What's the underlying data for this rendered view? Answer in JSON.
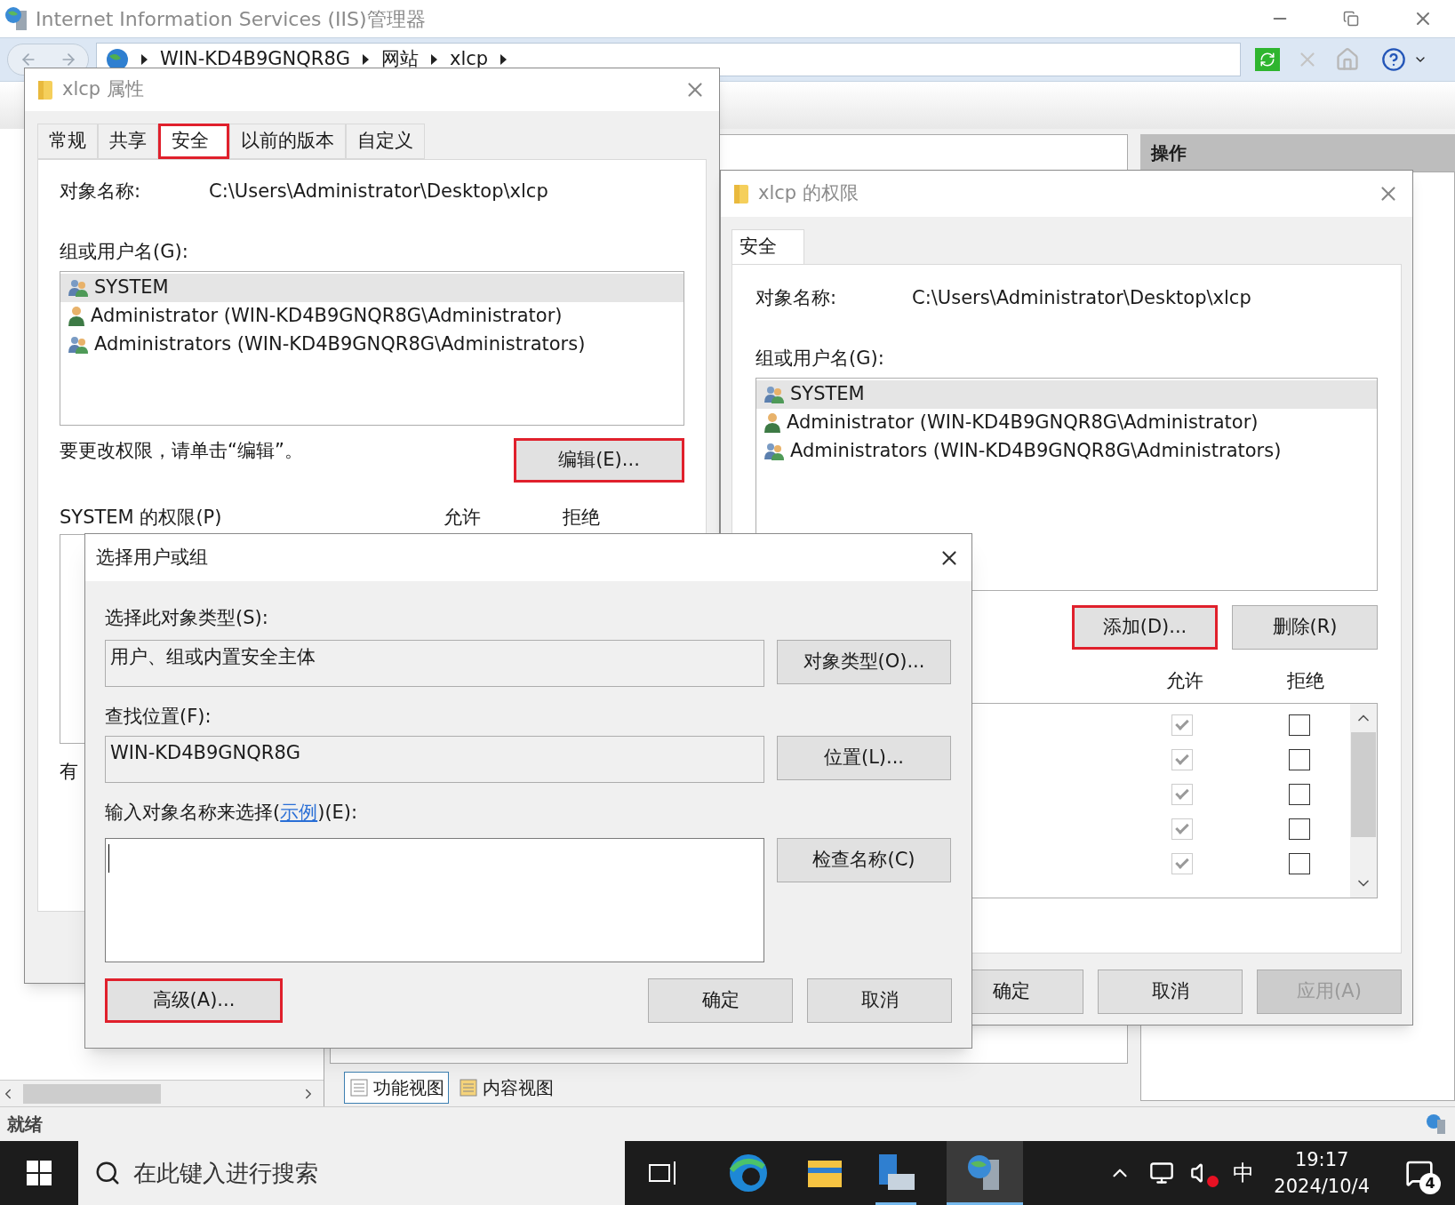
{
  "app": {
    "title": "Internet Information Services (IIS)管理器",
    "breadcrumb": [
      "WIN-KD4B9GNQR8G",
      "网站",
      "xlcp"
    ],
    "actions_header": "操作",
    "view_tabs": [
      {
        "label": "功能视图",
        "selected": true
      },
      {
        "label": "内容视图",
        "selected": false
      }
    ],
    "status": "就绪"
  },
  "properties_dialog": {
    "title": "xlcp 属性",
    "tabs": [
      {
        "label": "常规",
        "selected": false,
        "highlighted": false
      },
      {
        "label": "共享",
        "selected": false,
        "highlighted": false
      },
      {
        "label": "安全",
        "selected": true,
        "highlighted": true
      },
      {
        "label": "以前的版本",
        "selected": false,
        "highlighted": false
      },
      {
        "label": "自定义",
        "selected": false,
        "highlighted": false
      }
    ],
    "object_label": "对象名称:",
    "object_value": "C:\\Users\\Administrator\\Desktop\\xlcp",
    "users_label": "组或用户名(G):",
    "users": [
      {
        "name": "SYSTEM",
        "kind": "group",
        "selected": true
      },
      {
        "name": "Administrator (WIN-KD4B9GNQR8G\\Administrator)",
        "kind": "user",
        "selected": false
      },
      {
        "name": "Administrators (WIN-KD4B9GNQR8G\\Administrators)",
        "kind": "group",
        "selected": false
      }
    ],
    "hint": "要更改权限，请单击“编辑”。",
    "edit_button": {
      "label": "编辑(E)...",
      "highlighted": true
    },
    "permissions_label": "SYSTEM 的权限(P)",
    "allow_header": "允许",
    "deny_header": "拒绝",
    "footer_fragment": "有"
  },
  "permissions_dialog": {
    "title": "xlcp 的权限",
    "tabs": [
      {
        "label": "安全",
        "selected": true
      }
    ],
    "object_label": "对象名称:",
    "object_value": "C:\\Users\\Administrator\\Desktop\\xlcp",
    "users_label": "组或用户名(G):",
    "users": [
      {
        "name": "SYSTEM",
        "kind": "group",
        "selected": true
      },
      {
        "name": "Administrator (WIN-KD4B9GNQR8G\\Administrator)",
        "kind": "user",
        "selected": false
      },
      {
        "name": "Administrators (WIN-KD4B9GNQR8G\\Administrators)",
        "kind": "group",
        "selected": false
      }
    ],
    "buttons": [
      {
        "label": "添加(D)...",
        "highlighted": true
      },
      {
        "label": "删除(R)",
        "highlighted": false
      }
    ],
    "allow_header": "允许",
    "deny_header": "拒绝",
    "permissions": [
      {
        "allow": true,
        "allow_disabled": true,
        "deny": false
      },
      {
        "allow": true,
        "allow_disabled": true,
        "deny": false
      },
      {
        "allow": true,
        "allow_disabled": true,
        "deny": false
      },
      {
        "allow": true,
        "allow_disabled": true,
        "deny": false
      },
      {
        "allow": true,
        "allow_disabled": true,
        "deny": false
      }
    ],
    "footer_buttons": [
      {
        "label": "确定",
        "disabled": false
      },
      {
        "label": "取消",
        "disabled": false
      },
      {
        "label": "应用(A)",
        "disabled": true
      }
    ]
  },
  "select_dialog": {
    "title": "选择用户或组",
    "type_label": "选择此对象类型(S):",
    "type_value": "用户、组或内置安全主体",
    "type_button": "对象类型(O)...",
    "location_label": "查找位置(F):",
    "location_value": "WIN-KD4B9GNQR8G",
    "location_button": "位置(L)...",
    "names_label_before": "输入对象名称来选择(",
    "names_link": "示例",
    "names_label_after": ")(E):",
    "check_button": "检查名称(C)",
    "advanced_button": {
      "label": "高级(A)...",
      "highlighted": true
    },
    "footer_buttons": [
      "确定",
      "取消"
    ]
  },
  "taskbar": {
    "search_placeholder": "在此键入进行搜索",
    "ime": "中",
    "time": "19:17",
    "date": "2024/10/4",
    "notification_count": "4"
  }
}
